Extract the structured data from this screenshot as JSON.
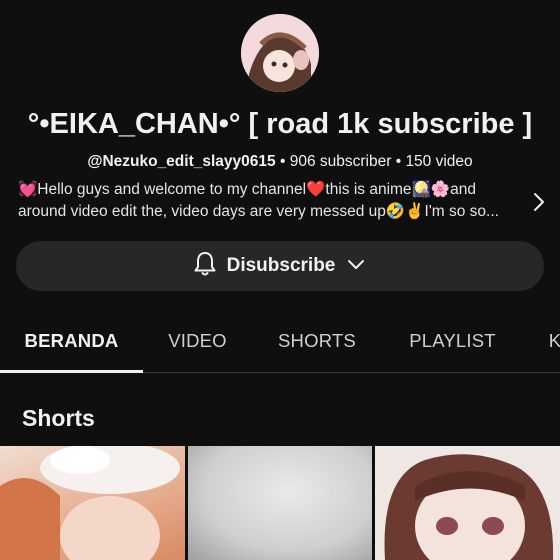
{
  "channel": {
    "name": "°•EIKA_CHAN•° [ road 1k subscribe ]",
    "handle": "@Nezuko_edit_slayy0615",
    "subscribers": "906 subscriber",
    "videos": "150 video",
    "separator": "•",
    "description_line1": "💓Hello guys and welcome to my channel❤️this is anime🎑🌸and",
    "description_line2": "around video edit the, video days are very messed up🤣✌️I'm so so..."
  },
  "subscribe_button": {
    "label": "Disubscribe"
  },
  "tabs": [
    {
      "label": "BERANDA",
      "active": true
    },
    {
      "label": "VIDEO",
      "active": false
    },
    {
      "label": "SHORTS",
      "active": false
    },
    {
      "label": "PLAYLIST",
      "active": false
    },
    {
      "label": "K",
      "active": false
    }
  ],
  "shorts_section": {
    "title": "Shorts"
  },
  "colors": {
    "background": "#0f0f0f",
    "button": "#272727",
    "text": "#f1f1f1",
    "muted": "#aaaaaa"
  },
  "icons": [
    "bell-icon",
    "chevron-down-icon",
    "chevron-right-icon"
  ]
}
